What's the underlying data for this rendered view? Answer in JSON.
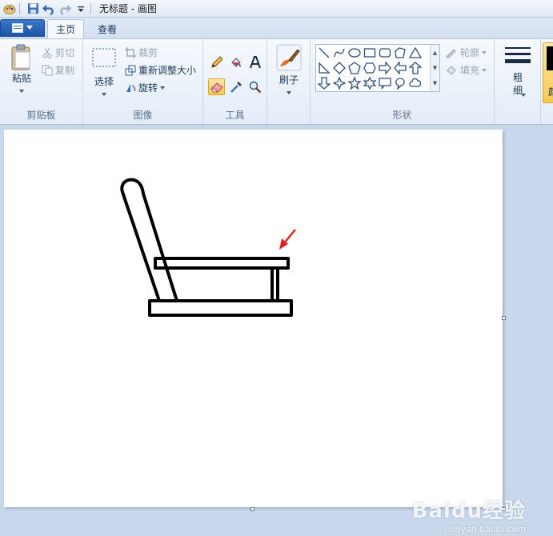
{
  "window": {
    "title": "无标题 - 画图"
  },
  "ribbon": {
    "tabs": [
      {
        "label": "主页",
        "active": true
      },
      {
        "label": "查看",
        "active": false
      }
    ],
    "groups": {
      "clipboard": {
        "label": "剪贴板",
        "paste": "粘贴",
        "cut": "剪切",
        "copy": "复制"
      },
      "image": {
        "label": "图像",
        "select": "选择",
        "crop": "裁剪",
        "resize": "重新调整大小",
        "rotate": "旋转"
      },
      "tools": {
        "label": "工具",
        "items": [
          "pencil-icon",
          "fill-icon",
          "text-icon",
          "eraser-icon",
          "color-picker-icon",
          "magnifier-icon"
        ],
        "selected": "eraser-icon"
      },
      "brushes": {
        "label": "刷子"
      },
      "shapes": {
        "label": "形状",
        "outline": "轮廓",
        "fill": "填充"
      },
      "size": {
        "label": "粗细"
      },
      "colors": {
        "label": "颜"
      }
    }
  },
  "colors": {
    "accent": "#1d54a6",
    "annotation_arrow": "#e02020",
    "drawing_stroke": "#000000"
  },
  "watermark": {
    "brand": "Baidu经验",
    "url": "jingyan.baidu.com"
  }
}
